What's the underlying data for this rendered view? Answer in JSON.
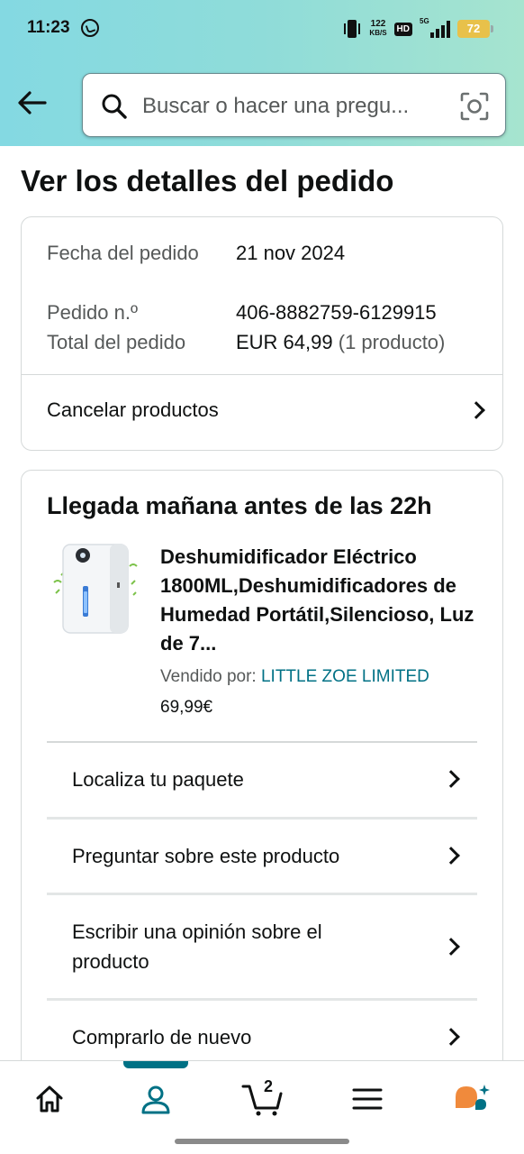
{
  "status_bar": {
    "time": "11:23",
    "net_speed_value": "122",
    "net_speed_unit": "KB/S",
    "hd_label": "HD",
    "signal_label": "5G",
    "battery": "72"
  },
  "header": {
    "search_placeholder": "Buscar o hacer una pregu..."
  },
  "page": {
    "title": "Ver los detalles del pedido"
  },
  "order_summary": {
    "date_label": "Fecha del pedido",
    "date_value": "21 nov 2024",
    "order_number_label": "Pedido n.º",
    "order_number_value": "406-8882759-6129915",
    "total_label": "Total del pedido",
    "total_value": "EUR 64,99",
    "total_items": "(1 producto)",
    "cancel_label": "Cancelar productos"
  },
  "shipment": {
    "arrival": "Llegada mañana antes de las 22h",
    "product_title": "Deshumidificador Eléctrico 1800ML,Deshumidificadores de Humedad Portátil,Silencioso, Luz de 7...",
    "sold_by_label": "Vendido por:",
    "seller": "LITTLE ZOE LIMITED",
    "price": "69,99€",
    "actions": [
      {
        "label": "Localiza tu paquete"
      },
      {
        "label": "Preguntar sobre este producto"
      },
      {
        "label": "Escribir una opinión sobre el producto"
      },
      {
        "label": "Comprarlo de nuevo"
      }
    ]
  },
  "bottom_nav": {
    "cart_count": "2",
    "active_tab": "account",
    "accent_color": "#007185",
    "assistant_color": "#f08a3c"
  }
}
